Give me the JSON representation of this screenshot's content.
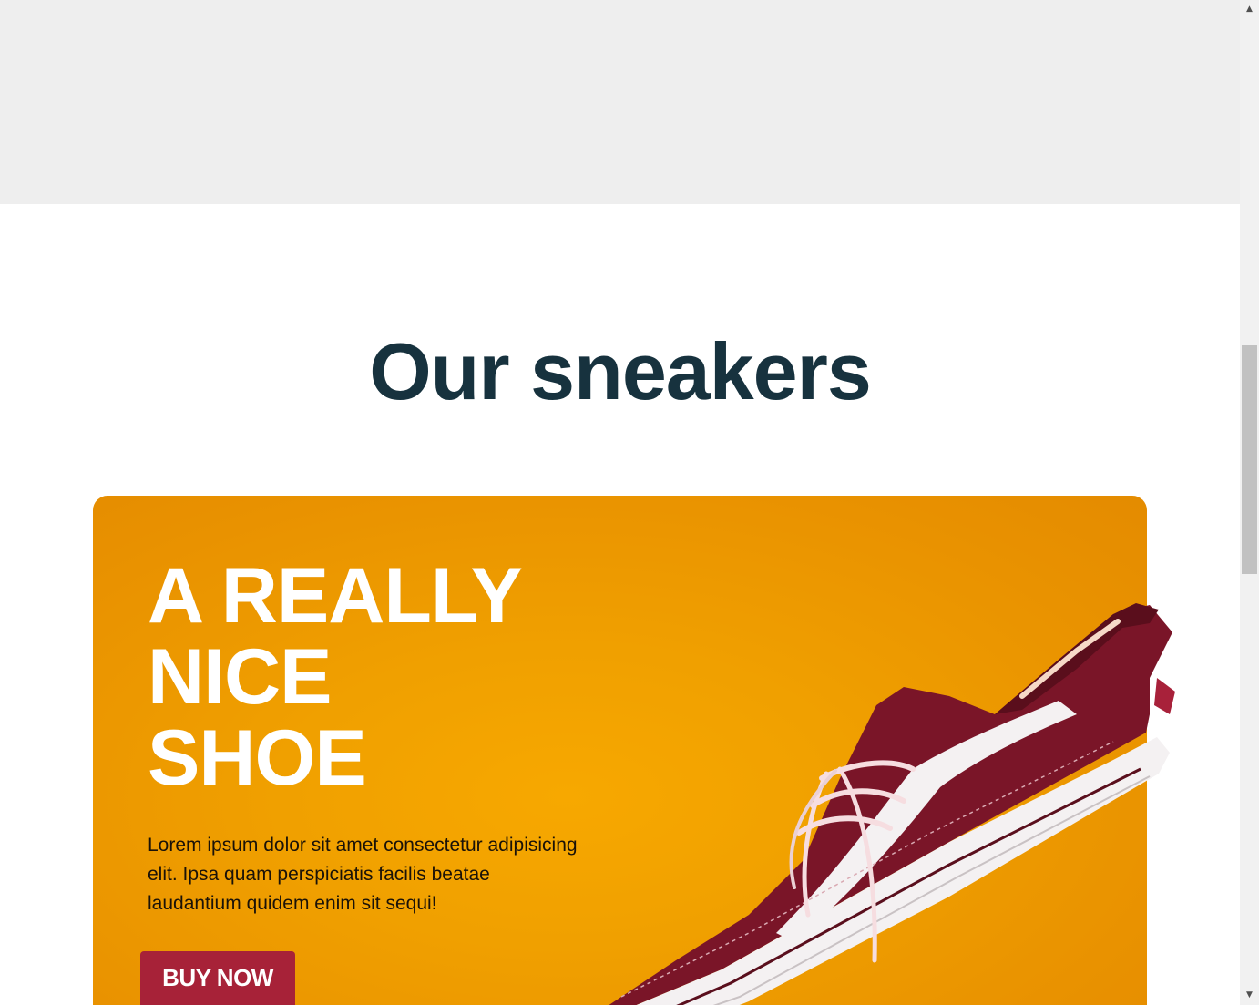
{
  "section": {
    "title": "Our sneakers"
  },
  "product_card": {
    "headline_lines": [
      "A REALLY",
      "NICE",
      "SHOE"
    ],
    "description": "Lorem ipsum dolor sit amet consectetur adipisicing elit. Ipsa quam perspiciatis facilis beatae laudantium quidem enim sit sequi!",
    "buy_label": "BUY NOW"
  },
  "scrollbar": {
    "up_arrow": "▲",
    "down_arrow": "▼"
  },
  "colors": {
    "top_band": "#eeeeee",
    "title": "#17323e",
    "card_bg": "#f0a000",
    "button": "#a72238",
    "shoe_canvas": "#7a1528",
    "shoe_sole": "#f4f1f2"
  },
  "icons": {
    "scroll_up": "triangle-up-icon",
    "scroll_down": "triangle-down-icon"
  }
}
